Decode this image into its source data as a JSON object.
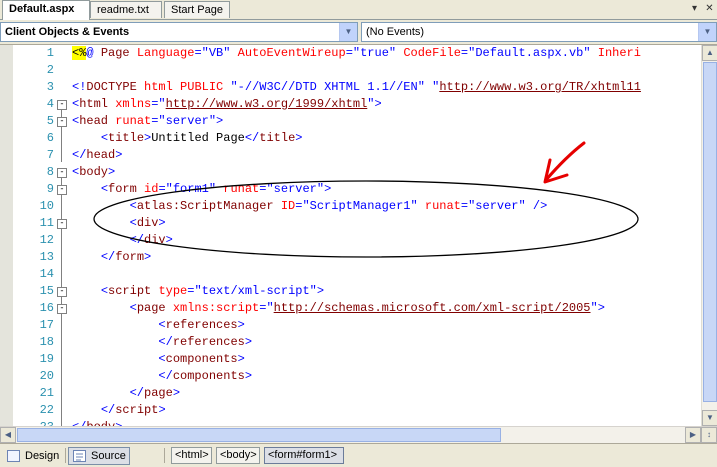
{
  "tabs": [
    {
      "label": "Default.aspx",
      "active": true
    },
    {
      "label": "readme.txt",
      "active": false
    },
    {
      "label": "Start Page",
      "active": false
    }
  ],
  "tab_controls": {
    "close_glyph": "✕"
  },
  "dropdowns": {
    "objects": "Client Objects & Events",
    "events": "(No Events)"
  },
  "lines": [
    {
      "n": "1",
      "indent": "",
      "tokens": [
        [
          "hl",
          "<%"
        ],
        [
          "val",
          "@"
        ],
        [
          "text",
          " "
        ],
        [
          "tag",
          "Page"
        ],
        [
          "text",
          " "
        ],
        [
          "attr",
          "Language"
        ],
        [
          "val",
          "=\"VB\""
        ],
        [
          "text",
          " "
        ],
        [
          "attr",
          "AutoEventWireup"
        ],
        [
          "val",
          "=\"true\""
        ],
        [
          "text",
          " "
        ],
        [
          "attr",
          "CodeFile"
        ],
        [
          "val",
          "=\"Default.aspx.vb\""
        ],
        [
          "text",
          " "
        ],
        [
          "attr",
          "Inheri"
        ]
      ]
    },
    {
      "n": "2",
      "tokens": []
    },
    {
      "n": "3",
      "tokens": [
        [
          "val",
          "<!"
        ],
        [
          "tag",
          "DOCTYPE"
        ],
        [
          "text",
          " "
        ],
        [
          "attr",
          "html"
        ],
        [
          "text",
          " "
        ],
        [
          "attr",
          "PUBLIC"
        ],
        [
          "text",
          " "
        ],
        [
          "val",
          "\"-//W3C//DTD XHTML 1.1//EN\""
        ],
        [
          "text",
          " "
        ],
        [
          "val",
          "\""
        ],
        [
          "link",
          "http://www.w3.org/TR/xhtml11"
        ]
      ]
    },
    {
      "n": "4",
      "fold": "-",
      "tokens": [
        [
          "val",
          "<"
        ],
        [
          "tag",
          "html"
        ],
        [
          "text",
          " "
        ],
        [
          "attr",
          "xmlns"
        ],
        [
          "val",
          "=\""
        ],
        [
          "link",
          "http://www.w3.org/1999/xhtml"
        ],
        [
          "val",
          "\">"
        ]
      ]
    },
    {
      "n": "5",
      "fold": "-",
      "tokens": [
        [
          "val",
          "<"
        ],
        [
          "tag",
          "head"
        ],
        [
          "text",
          " "
        ],
        [
          "attr",
          "runat"
        ],
        [
          "val",
          "=\"server\">"
        ]
      ]
    },
    {
      "n": "6",
      "tokens": [
        [
          "text",
          "    "
        ],
        [
          "val",
          "<"
        ],
        [
          "tag",
          "title"
        ],
        [
          "val",
          ">"
        ],
        [
          "text",
          "Untitled Page"
        ],
        [
          "val",
          "</"
        ],
        [
          "tag",
          "title"
        ],
        [
          "val",
          ">"
        ]
      ]
    },
    {
      "n": "7",
      "tokens": [
        [
          "val",
          "</"
        ],
        [
          "tag",
          "head"
        ],
        [
          "val",
          ">"
        ]
      ]
    },
    {
      "n": "8",
      "fold": "-",
      "tokens": [
        [
          "val",
          "<"
        ],
        [
          "tag",
          "body"
        ],
        [
          "val",
          ">"
        ]
      ]
    },
    {
      "n": "9",
      "fold": "-",
      "tokens": [
        [
          "text",
          "    "
        ],
        [
          "val",
          "<"
        ],
        [
          "tag",
          "form"
        ],
        [
          "text",
          " "
        ],
        [
          "attr",
          "id"
        ],
        [
          "val",
          "=\"form1\""
        ],
        [
          "text",
          " "
        ],
        [
          "attr",
          "runat"
        ],
        [
          "val",
          "=\"server\">"
        ]
      ]
    },
    {
      "n": "10",
      "tokens": [
        [
          "text",
          "        "
        ],
        [
          "val",
          "<"
        ],
        [
          "tag",
          "atlas:ScriptManager"
        ],
        [
          "text",
          " "
        ],
        [
          "attr",
          "ID"
        ],
        [
          "val",
          "=\"ScriptManager1\""
        ],
        [
          "text",
          " "
        ],
        [
          "attr",
          "runat"
        ],
        [
          "val",
          "=\"server\""
        ],
        [
          "text",
          " "
        ],
        [
          "val",
          "/>"
        ]
      ]
    },
    {
      "n": "11",
      "fold": "-",
      "tokens": [
        [
          "text",
          "        "
        ],
        [
          "val",
          "<"
        ],
        [
          "tag",
          "div"
        ],
        [
          "val",
          ">"
        ]
      ]
    },
    {
      "n": "12",
      "tokens": [
        [
          "text",
          "        "
        ],
        [
          "val",
          "</"
        ],
        [
          "tag",
          "div"
        ],
        [
          "val",
          ">"
        ]
      ]
    },
    {
      "n": "13",
      "tokens": [
        [
          "text",
          "    "
        ],
        [
          "val",
          "</"
        ],
        [
          "tag",
          "form"
        ],
        [
          "val",
          ">"
        ]
      ]
    },
    {
      "n": "14",
      "tokens": []
    },
    {
      "n": "15",
      "fold": "-",
      "tokens": [
        [
          "text",
          "    "
        ],
        [
          "val",
          "<"
        ],
        [
          "tag",
          "script"
        ],
        [
          "text",
          " "
        ],
        [
          "attr",
          "type"
        ],
        [
          "val",
          "=\"text/xml-script\">"
        ]
      ]
    },
    {
      "n": "16",
      "fold": "-",
      "tokens": [
        [
          "text",
          "        "
        ],
        [
          "val",
          "<"
        ],
        [
          "tag",
          "page"
        ],
        [
          "text",
          " "
        ],
        [
          "attr",
          "xmlns:script"
        ],
        [
          "val",
          "=\""
        ],
        [
          "link",
          "http://schemas.microsoft.com/xml-script/2005"
        ],
        [
          "val",
          "\">"
        ]
      ]
    },
    {
      "n": "17",
      "tokens": [
        [
          "text",
          "            "
        ],
        [
          "val",
          "<"
        ],
        [
          "tag",
          "references"
        ],
        [
          "val",
          ">"
        ]
      ]
    },
    {
      "n": "18",
      "tokens": [
        [
          "text",
          "            "
        ],
        [
          "val",
          "</"
        ],
        [
          "tag",
          "references"
        ],
        [
          "val",
          ">"
        ]
      ]
    },
    {
      "n": "19",
      "tokens": [
        [
          "text",
          "            "
        ],
        [
          "val",
          "<"
        ],
        [
          "tag",
          "components"
        ],
        [
          "val",
          ">"
        ]
      ]
    },
    {
      "n": "20",
      "tokens": [
        [
          "text",
          "            "
        ],
        [
          "val",
          "</"
        ],
        [
          "tag",
          "components"
        ],
        [
          "val",
          ">"
        ]
      ]
    },
    {
      "n": "21",
      "tokens": [
        [
          "text",
          "        "
        ],
        [
          "val",
          "</"
        ],
        [
          "tag",
          "page"
        ],
        [
          "val",
          ">"
        ]
      ]
    },
    {
      "n": "22",
      "tokens": [
        [
          "text",
          "    "
        ],
        [
          "val",
          "</"
        ],
        [
          "tag",
          "script"
        ],
        [
          "val",
          ">"
        ]
      ]
    },
    {
      "n": "23",
      "tokens": [
        [
          "val",
          "</"
        ],
        [
          "tag",
          "body"
        ],
        [
          "val",
          ">"
        ]
      ]
    }
  ],
  "view_buttons": [
    {
      "label": "Design",
      "active": false
    },
    {
      "label": "Source",
      "active": true
    }
  ],
  "breadcrumbs": [
    {
      "label": "<html>",
      "active": false
    },
    {
      "label": "<body>",
      "active": false
    },
    {
      "label": "<form#form1>",
      "active": true
    }
  ],
  "colors": {
    "annotation": "#e60000",
    "tag": "#800000",
    "attribute": "#ff0000",
    "value": "#0000ff",
    "line_number": "#2b91af"
  }
}
